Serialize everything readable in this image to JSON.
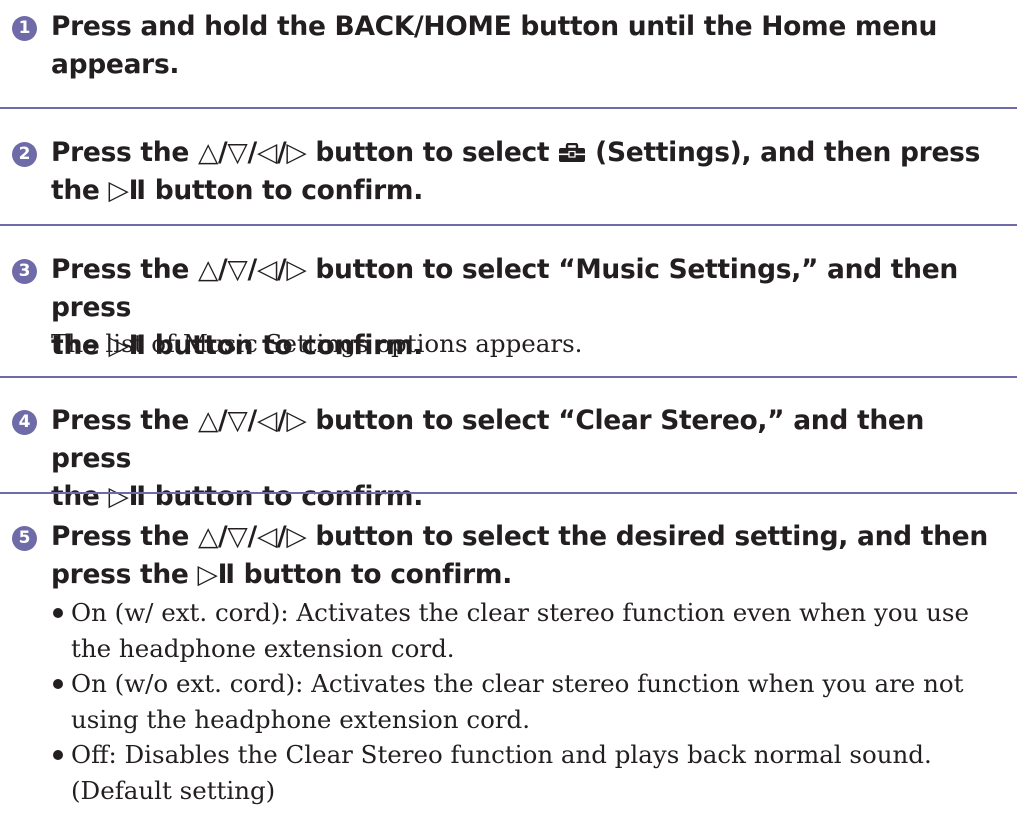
{
  "steps": [
    {
      "number": "1",
      "instruction_lines": [
        "Press and hold the BACK/HOME button until the Home menu",
        "appears."
      ]
    },
    {
      "number": "2",
      "instruction_line1_pre": "Press the △/▽/◁/▷ button to select",
      "settings_icon": "toolbox-icon",
      "instruction_line1_post": "(Settings), and then press",
      "instruction_line2": "the ▷Ⅱ button to confirm."
    },
    {
      "number": "3",
      "instruction_lines": [
        "Press the △/▽/◁/▷ button to select “Music Settings,” and then press",
        "the ▷Ⅱ button to confirm."
      ],
      "description": "The list of Music Settings options appears."
    },
    {
      "number": "4",
      "instruction_lines": [
        "Press the △/▽/◁/▷ button to select “Clear Stereo,” and then press",
        "the ▷Ⅱ button to confirm."
      ]
    },
    {
      "number": "5",
      "instruction_lines": [
        "Press the △/▽/◁/▷ button to select the desired setting, and then",
        "press the ▷Ⅱ button to confirm."
      ],
      "options": [
        [
          "On (w/ ext. cord): Activates the clear stereo function even when you use",
          "the headphone extension cord."
        ],
        [
          "On (w/o ext. cord): Activates the clear stereo function when you are not",
          "using the headphone extension cord."
        ],
        [
          "Off: Disables the Clear Stereo function and plays back normal sound.",
          "(Default setting)"
        ]
      ]
    }
  ],
  "colors": {
    "accent": "#6f6aa8",
    "text": "#231f20",
    "background": "#ffffff"
  }
}
